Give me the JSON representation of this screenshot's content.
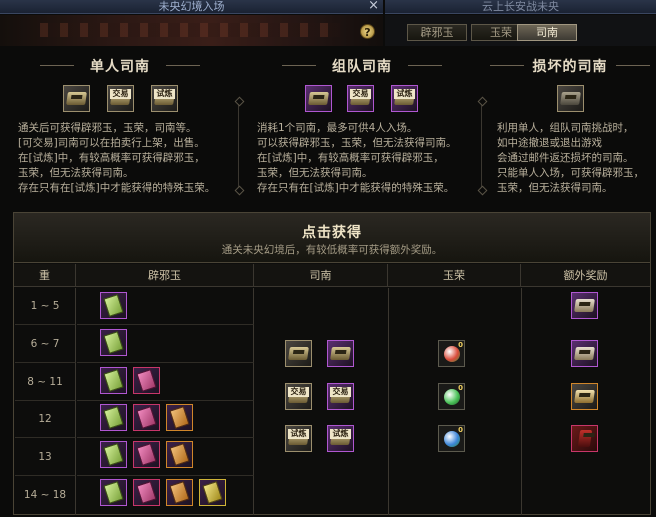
{
  "window": {
    "left_title": "未央幻境入场",
    "right_title": "云上长安战未央",
    "close_symbol": "×",
    "help_symbol": "?"
  },
  "tabs": [
    {
      "label": "辟邪玉",
      "active": false
    },
    {
      "label": "玉荣",
      "active": false
    },
    {
      "label": "司南",
      "active": true
    }
  ],
  "sections": {
    "solo": {
      "title": "单人司南",
      "lines": [
        "通关后可获得辟邪玉，玉荣，司南等。",
        "[可交易]司南可以在拍卖行上架，出售。",
        "在[试炼]中，有较高概率可获得辟邪玉，",
        "玉荣，但无法获得司南。",
        "存在只有在[试炼]中才能获得的特殊玉荣。"
      ]
    },
    "party": {
      "title": "组队司南",
      "lines": [
        "消耗1个司南，最多可供4人入场。",
        "可以获得辟邪玉，玉荣，但无法获得司南。",
        "在[试炼]中，有较高概率可获得辟邪玉，",
        "玉荣，但无法获得司南。",
        "存在只有在[试炼]中才能获得的特殊玉荣。"
      ]
    },
    "broken": {
      "title": "损坏的司南",
      "lines": [
        "利用单人，组队司南挑战时，",
        "如中途撤退或退出游戏",
        "会通过邮件返还损坏的司南。",
        "只能单人入场，可获得辟邪玉，",
        "玉荣，但无法获得司南。"
      ]
    }
  },
  "icon_labels": {
    "trade": "交易",
    "trial": "试炼"
  },
  "rewards": {
    "title": "点击获得",
    "subtitle": "通关未央幻境后，有较低概率可获得额外奖励。",
    "columns": [
      "重",
      "辟邪玉",
      "司南",
      "玉荣",
      "额外奖励"
    ],
    "levels": [
      "1 ~ 5",
      "6 ~ 7",
      "8 ~ 11",
      "12",
      "13",
      "14 ~ 18"
    ],
    "orb_count": "0"
  },
  "colors": {
    "accent_gold": "#e6dcc6",
    "purple_border": "#b057d1",
    "active_tab": "#6e6656"
  }
}
